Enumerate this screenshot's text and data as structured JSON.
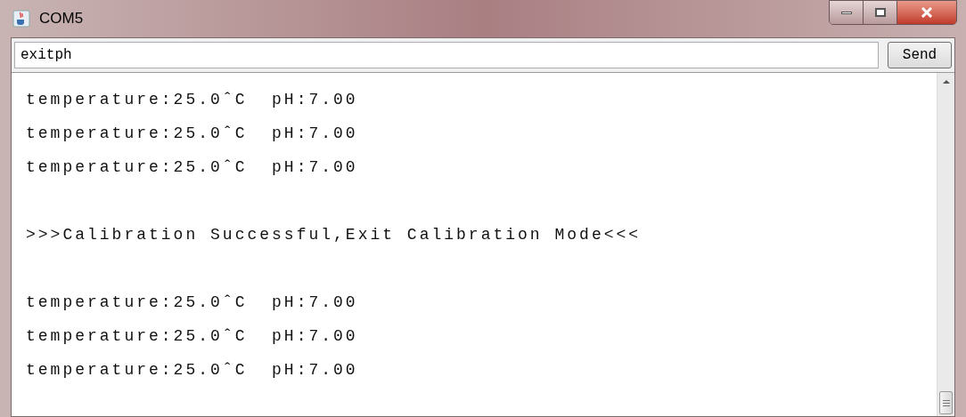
{
  "window": {
    "title": "COM5"
  },
  "input": {
    "value": "exitph"
  },
  "send_button": {
    "label": "Send"
  },
  "output_lines": [
    {
      "kind": "text",
      "text": "temperature:25.0ˆC  pH:7.00"
    },
    {
      "kind": "text",
      "text": "temperature:25.0ˆC  pH:7.00"
    },
    {
      "kind": "text",
      "text": "temperature:25.0ˆC  pH:7.00"
    },
    {
      "kind": "blank"
    },
    {
      "kind": "text",
      "text": ">>>Calibration Successful,Exit Calibration Mode<<<"
    },
    {
      "kind": "blank"
    },
    {
      "kind": "text",
      "text": "temperature:25.0ˆC  pH:7.00"
    },
    {
      "kind": "text",
      "text": "temperature:25.0ˆC  pH:7.00"
    },
    {
      "kind": "text",
      "text": "temperature:25.0ˆC  pH:7.00"
    }
  ]
}
